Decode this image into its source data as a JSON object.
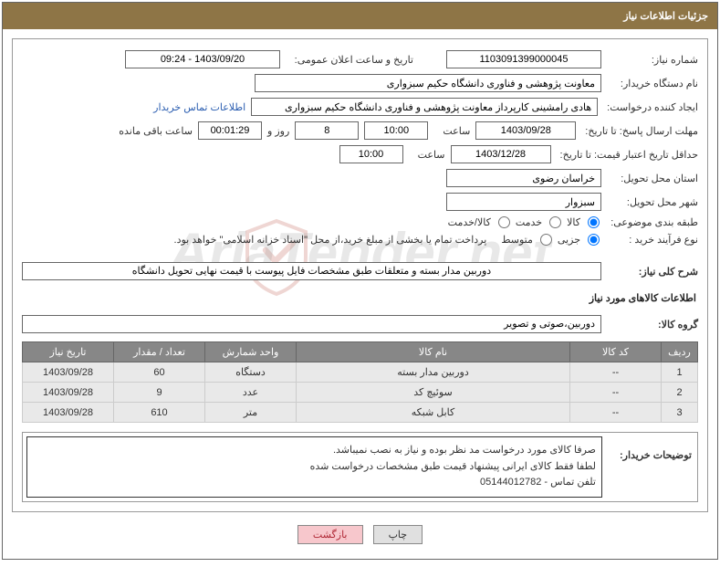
{
  "header": {
    "title": "جزئیات اطلاعات نیاز"
  },
  "fields": {
    "need_number_label": "شماره نیاز:",
    "need_number": "1103091399000045",
    "announce_label": "تاریخ و ساعت اعلان عمومی:",
    "announce_value": "1403/09/20 - 09:24",
    "buyer_label": "نام دستگاه خریدار:",
    "buyer_value": "معاونت پژوهشی و فناوری دانشگاه حکیم سبزواری",
    "creator_label": "ایجاد کننده درخواست:",
    "creator_value": "هادی رامشینی کارپرداز معاونت پژوهشی و فناوری دانشگاه حکیم سبزواری",
    "contact_link": "اطلاعات تماس خریدار",
    "deadline_send_label": "مهلت ارسال پاسخ: تا تاریخ:",
    "deadline_send_date": "1403/09/28",
    "time_label": "ساعت",
    "deadline_send_time": "10:00",
    "days_remaining": "8",
    "days_label": "روز و",
    "countdown": "00:01:29",
    "remaining_label": "ساعت باقی مانده",
    "validity_label": "حداقل تاریخ اعتبار قیمت: تا تاریخ:",
    "validity_date": "1403/12/28",
    "validity_time": "10:00",
    "province_label": "استان محل تحویل:",
    "province_value": "خراسان رضوی",
    "city_label": "شهر محل تحویل:",
    "city_value": "سبزوار",
    "class_label": "طبقه بندی موضوعی:",
    "class_opt1": "کالا",
    "class_opt2": "خدمت",
    "class_opt3": "کالا/خدمت",
    "process_label": "نوع فرآیند خرید :",
    "process_opt1": "جزیی",
    "process_opt2": "متوسط",
    "process_note": "پرداخت تمام یا بخشی از مبلغ خرید،از محل \"اسناد خزانه اسلامی\" خواهد بود.",
    "description_label": "شرح کلی نیاز:",
    "description_value": "دوربین مدار بسته و متعلقات طبق مشخصات فایل پیوست با قیمت نهایی تحویل دانشگاه",
    "goods_info_title": "اطلاعات کالاهای مورد نیاز",
    "group_label": "گروه کالا:",
    "group_value": "دوربین،صوتی و تصویر"
  },
  "table": {
    "headers": {
      "row": "ردیف",
      "code": "کد کالا",
      "name": "نام کالا",
      "unit": "واحد شمارش",
      "qty": "تعداد / مقدار",
      "date": "تاریخ نیاز"
    },
    "rows": [
      {
        "row": "1",
        "code": "--",
        "name": "دوربین مدار بسته",
        "unit": "دستگاه",
        "qty": "60",
        "date": "1403/09/28"
      },
      {
        "row": "2",
        "code": "--",
        "name": "سوئیچ کد",
        "unit": "عدد",
        "qty": "9",
        "date": "1403/09/28"
      },
      {
        "row": "3",
        "code": "--",
        "name": "کابل شبکه",
        "unit": "متر",
        "qty": "610",
        "date": "1403/09/28"
      }
    ]
  },
  "explain": {
    "label": "توضیحات خریدار:",
    "line1": "صرفا کالای مورد درخواست مد نظر بوده و نیاز به نصب نمیباشد.",
    "line2": "لطفا فقط کالای ایرانی پیشنهاد قیمت طبق مشخصات درخواست شده",
    "line3": "تلفن تماس - 05144012782"
  },
  "buttons": {
    "print": "چاپ",
    "back": "بازگشت"
  },
  "watermark": "AriaTender.net"
}
